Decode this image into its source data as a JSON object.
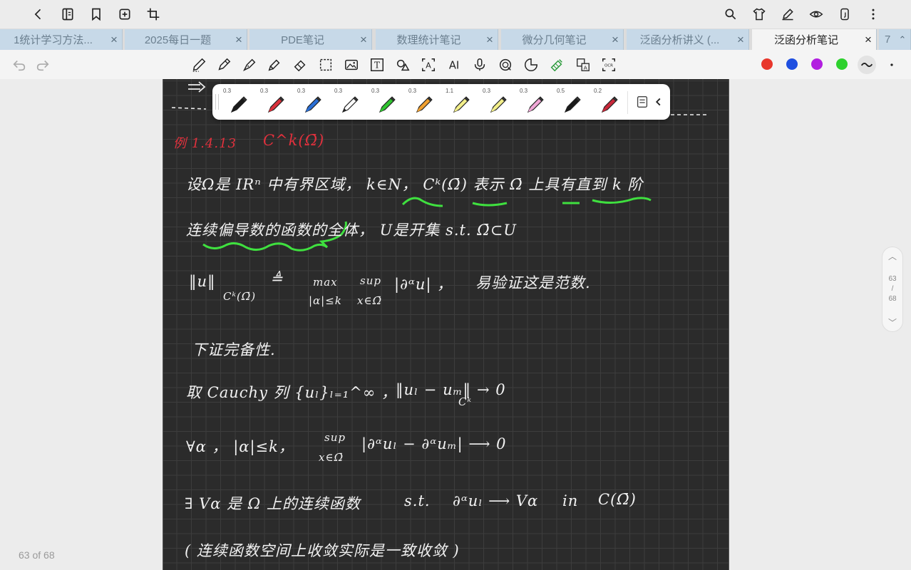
{
  "topbar": {
    "left_icons": [
      "back-icon",
      "outline-icon",
      "bookmark-icon",
      "add-page-icon",
      "crop-icon"
    ],
    "right_icons": [
      "search-icon",
      "shirt-icon",
      "pen-edit-icon",
      "eye-icon",
      "device-icon",
      "more-vert-icon"
    ]
  },
  "tabs": [
    {
      "label": "1统计学习方法...",
      "active": false
    },
    {
      "label": "2025每日一题",
      "active": false
    },
    {
      "label": "PDE笔记",
      "active": false
    },
    {
      "label": "数理统计笔记",
      "active": false
    },
    {
      "label": "微分几何笔记",
      "active": false
    },
    {
      "label": "泛函分析讲义 (...",
      "active": false
    },
    {
      "label": "泛函分析笔记",
      "active": true
    },
    {
      "label": "7",
      "active": false
    }
  ],
  "tab_close": "×",
  "tools": [
    "undo-icon",
    "redo-icon",
    "pencil-icon",
    "pen-icon",
    "fountain-pen-icon",
    "highlighter-icon",
    "eraser-icon",
    "lasso-select-icon",
    "image-icon",
    "text-box-icon",
    "shapes-icon",
    "text-recognize-icon",
    "ai-icon",
    "mic-icon",
    "sticker-icon",
    "shape-stamp-icon",
    "tape-icon",
    "translate-icon",
    "ocr-icon"
  ],
  "tool_labels": {
    "ai": "AI",
    "ocr": "OCR",
    "text": "T"
  },
  "colors": [
    "#e8372c",
    "#1f4fe0",
    "#b21ee0",
    "#2ed12e"
  ],
  "pens": [
    {
      "size": "0.3",
      "color": "#1a1a1a"
    },
    {
      "size": "0.3",
      "color": "#d9303a"
    },
    {
      "size": "0.3",
      "color": "#2a6fd6"
    },
    {
      "size": "0.3",
      "color": "#ffffff"
    },
    {
      "size": "0.3",
      "color": "#2fc42f"
    },
    {
      "size": "0.3",
      "color": "#f0a030"
    },
    {
      "size": "1.1",
      "color": "#f3ef8a"
    },
    {
      "size": "0.3",
      "color": "#f3ef8a"
    },
    {
      "size": "0.3",
      "color": "#f0a6d6"
    },
    {
      "size": "0.5",
      "color": "#1a1a1a"
    },
    {
      "size": "0.2",
      "color": "#c8283a"
    }
  ],
  "note": {
    "heading_num": "例 1.4.13",
    "heading_space": "C^k(Ω̄)",
    "line1": "设Ω是 IRⁿ 中有界区域， k∈N， Cᵏ(Ω̄) 表示 Ω̄ 上具有直到 k 阶",
    "line2": "连续偏导数的函数的全体， U是开集 s.t. Ω̄⊂U",
    "norm_lhs": "‖u‖",
    "norm_sub": "Cᵏ(Ω̄)",
    "norm_def": "≜",
    "norm_max": "max",
    "norm_max_sub": "|α|≤k",
    "norm_sup": "sup",
    "norm_sup_sub": "x∈Ω̄",
    "norm_body": "|∂ᵅu| ，",
    "norm_note": "易验证这是范数.",
    "completeness": "下证完备性.",
    "cauchy": "取 Cauchy 列 {uₗ}ₗ₌₁^∞ ，",
    "cauchy_conv": "‖uₗ − uₘ‖",
    "cauchy_conv_sub": "Cᵏ",
    "cauchy_conv_tail": "→ 0",
    "forall": "∀α ， |α|≤k，",
    "forall_sup": "sup",
    "forall_sup_sub": "x∈Ω̄",
    "forall_body": "|∂ᵅuₗ − ∂ᵅuₘ| ⟶ 0",
    "exists": "∃ Vα 是 Ω 上的连续函数",
    "exists_st": "s.t.",
    "exists_conv": "∂ᵅuₗ ⟶ Vα",
    "exists_in": "in",
    "exists_space": "C(Ω̄)",
    "remark": "( 连续函数空间上收敛实际是一致收敛 )"
  },
  "pager": {
    "current": "63",
    "sep": "/",
    "total": "68"
  },
  "page_count_label": "63 of 68"
}
